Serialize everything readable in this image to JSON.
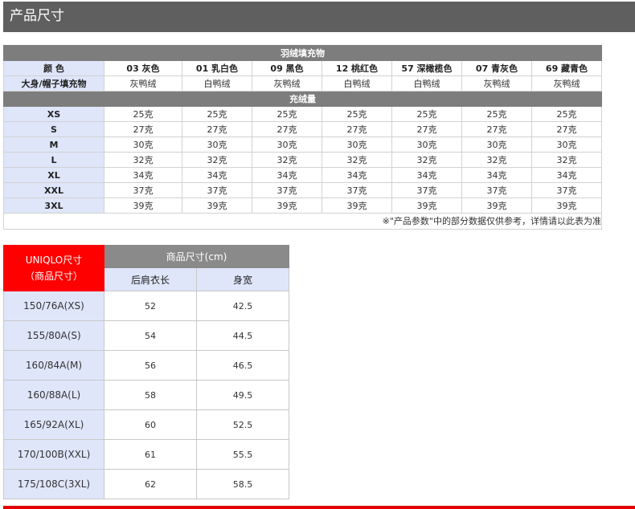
{
  "header": {
    "title": "产品尺寸"
  },
  "down_table": {
    "title": "羽绒填充物",
    "color_label": "颜 色",
    "colors": [
      "03 灰色",
      "01 乳白色",
      "09 黑色",
      "12 桃红色",
      "57 深橄榄色",
      "07 青灰色",
      "69 藏青色"
    ],
    "fill_label": "大身/帽子填充物",
    "fills": [
      "灰鸭绒",
      "白鸭绒",
      "灰鸭绒",
      "白鸭绒",
      "白鸭绒",
      "灰鸭绒",
      "灰鸭绒"
    ],
    "amount_title": "充绒量",
    "rows": [
      {
        "size": "XS",
        "values": [
          "25克",
          "25克",
          "25克",
          "25克",
          "25克",
          "25克",
          "25克"
        ]
      },
      {
        "size": "S",
        "values": [
          "27克",
          "27克",
          "27克",
          "27克",
          "27克",
          "27克",
          "27克"
        ]
      },
      {
        "size": "M",
        "values": [
          "30克",
          "30克",
          "30克",
          "30克",
          "30克",
          "30克",
          "30克"
        ]
      },
      {
        "size": "L",
        "values": [
          "32克",
          "32克",
          "32克",
          "32克",
          "32克",
          "32克",
          "32克"
        ]
      },
      {
        "size": "XL",
        "values": [
          "34克",
          "34克",
          "34克",
          "34克",
          "34克",
          "34克",
          "34克"
        ]
      },
      {
        "size": "XXL",
        "values": [
          "37克",
          "37克",
          "37克",
          "37克",
          "37克",
          "37克",
          "37克"
        ]
      },
      {
        "size": "3XL",
        "values": [
          "39克",
          "39克",
          "39克",
          "39克",
          "39克",
          "39克",
          "39克"
        ]
      }
    ],
    "note": "※\"产品参数\"中的部分数据仅供参考，详情请以此表为准"
  },
  "size_table": {
    "brand_line1": "UNIQLO尺寸",
    "brand_line2": "（商品尺寸）",
    "group_title": "商品尺寸(cm)",
    "col1": "后肩衣长",
    "col2": "身宽",
    "rows": [
      {
        "size": "150/76A(XS)",
        "length": "52",
        "width": "42.5"
      },
      {
        "size": "155/80A(S)",
        "length": "54",
        "width": "44.5"
      },
      {
        "size": "160/84A(M)",
        "length": "56",
        "width": "46.5"
      },
      {
        "size": "160/88A(L)",
        "length": "58",
        "width": "49.5"
      },
      {
        "size": "165/92A(XL)",
        "length": "60",
        "width": "52.5"
      },
      {
        "size": "170/100B(XXL)",
        "length": "61",
        "width": "55.5"
      },
      {
        "size": "175/108C(3XL)",
        "length": "62",
        "width": "58.5"
      }
    ]
  }
}
